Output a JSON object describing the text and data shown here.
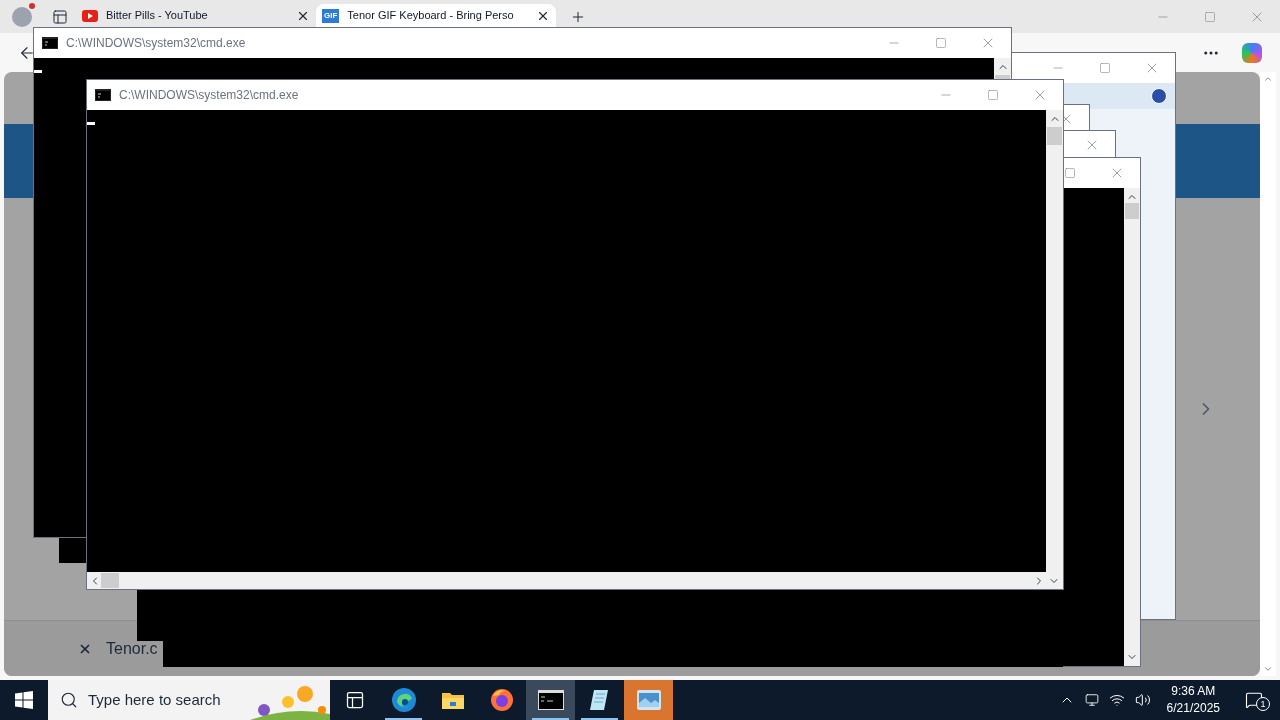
{
  "browser": {
    "tabs": [
      {
        "title": "Bitter Pills - YouTube",
        "kind": "video",
        "selected": false
      },
      {
        "title": "Tenor GIF Keyboard - Bring Perso",
        "kind": "gif",
        "icon_text": "GIF",
        "selected": true
      }
    ],
    "page": {
      "notice": "Tenor.c"
    }
  },
  "windows": [
    {
      "title": "C:\\WINDOWS\\system32\\cmd.exe"
    },
    {
      "title": "C:\\WINDOWS\\system32\\cmd.exe"
    }
  ],
  "taskbar": {
    "search_placeholder": "Type here to search",
    "apps": [
      {
        "kind": "taskview",
        "running": false,
        "selected": false,
        "flashing": false
      },
      {
        "kind": "edge",
        "running": true,
        "selected": false,
        "flashing": false
      },
      {
        "kind": "folder",
        "running": false,
        "selected": false,
        "flashing": false
      },
      {
        "kind": "firefox",
        "running": false,
        "selected": false,
        "flashing": false
      },
      {
        "kind": "terminal",
        "running": true,
        "selected": true,
        "flashing": false
      },
      {
        "kind": "notepad",
        "running": true,
        "selected": false,
        "flashing": false
      },
      {
        "kind": "photos",
        "running": false,
        "selected": false,
        "flashing": true
      }
    ],
    "time": "9:36 AM",
    "date": "6/21/2025",
    "notifications": "1"
  }
}
